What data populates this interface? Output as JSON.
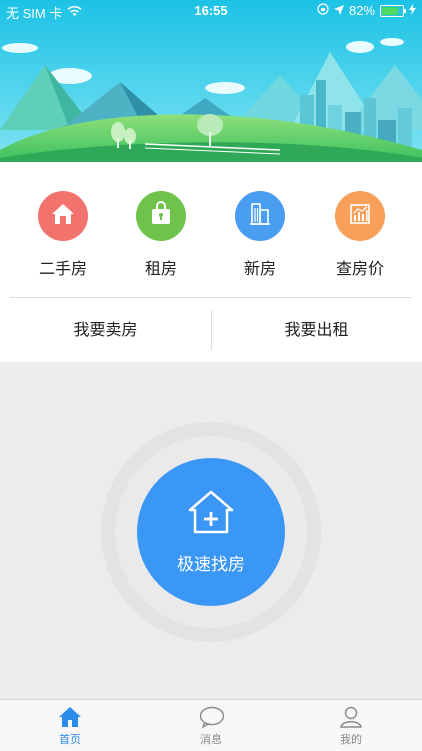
{
  "status_bar": {
    "carrier": "无 SIM 卡",
    "time": "16:55",
    "battery": "82%",
    "battery_level": 0.82
  },
  "categories": [
    {
      "label": "二手房",
      "icon": "house-icon",
      "color": "#f2736d"
    },
    {
      "label": "租房",
      "icon": "lock-bag-icon",
      "color": "#6fc24a"
    },
    {
      "label": "新房",
      "icon": "building-icon",
      "color": "#4a9ef2"
    },
    {
      "label": "查房价",
      "icon": "chart-icon",
      "color": "#f6a05a"
    }
  ],
  "actions": {
    "sell": "我要卖房",
    "rent_out": "我要出租"
  },
  "fast_find": {
    "label": "极速找房",
    "color": "#3b97f5"
  },
  "tabbar": {
    "active_color": "#2a8ce8",
    "inactive_color": "#8a8a8a",
    "items": [
      {
        "label": "首页",
        "icon": "home-icon"
      },
      {
        "label": "消息",
        "icon": "message-icon"
      },
      {
        "label": "我的",
        "icon": "profile-icon"
      }
    ]
  }
}
